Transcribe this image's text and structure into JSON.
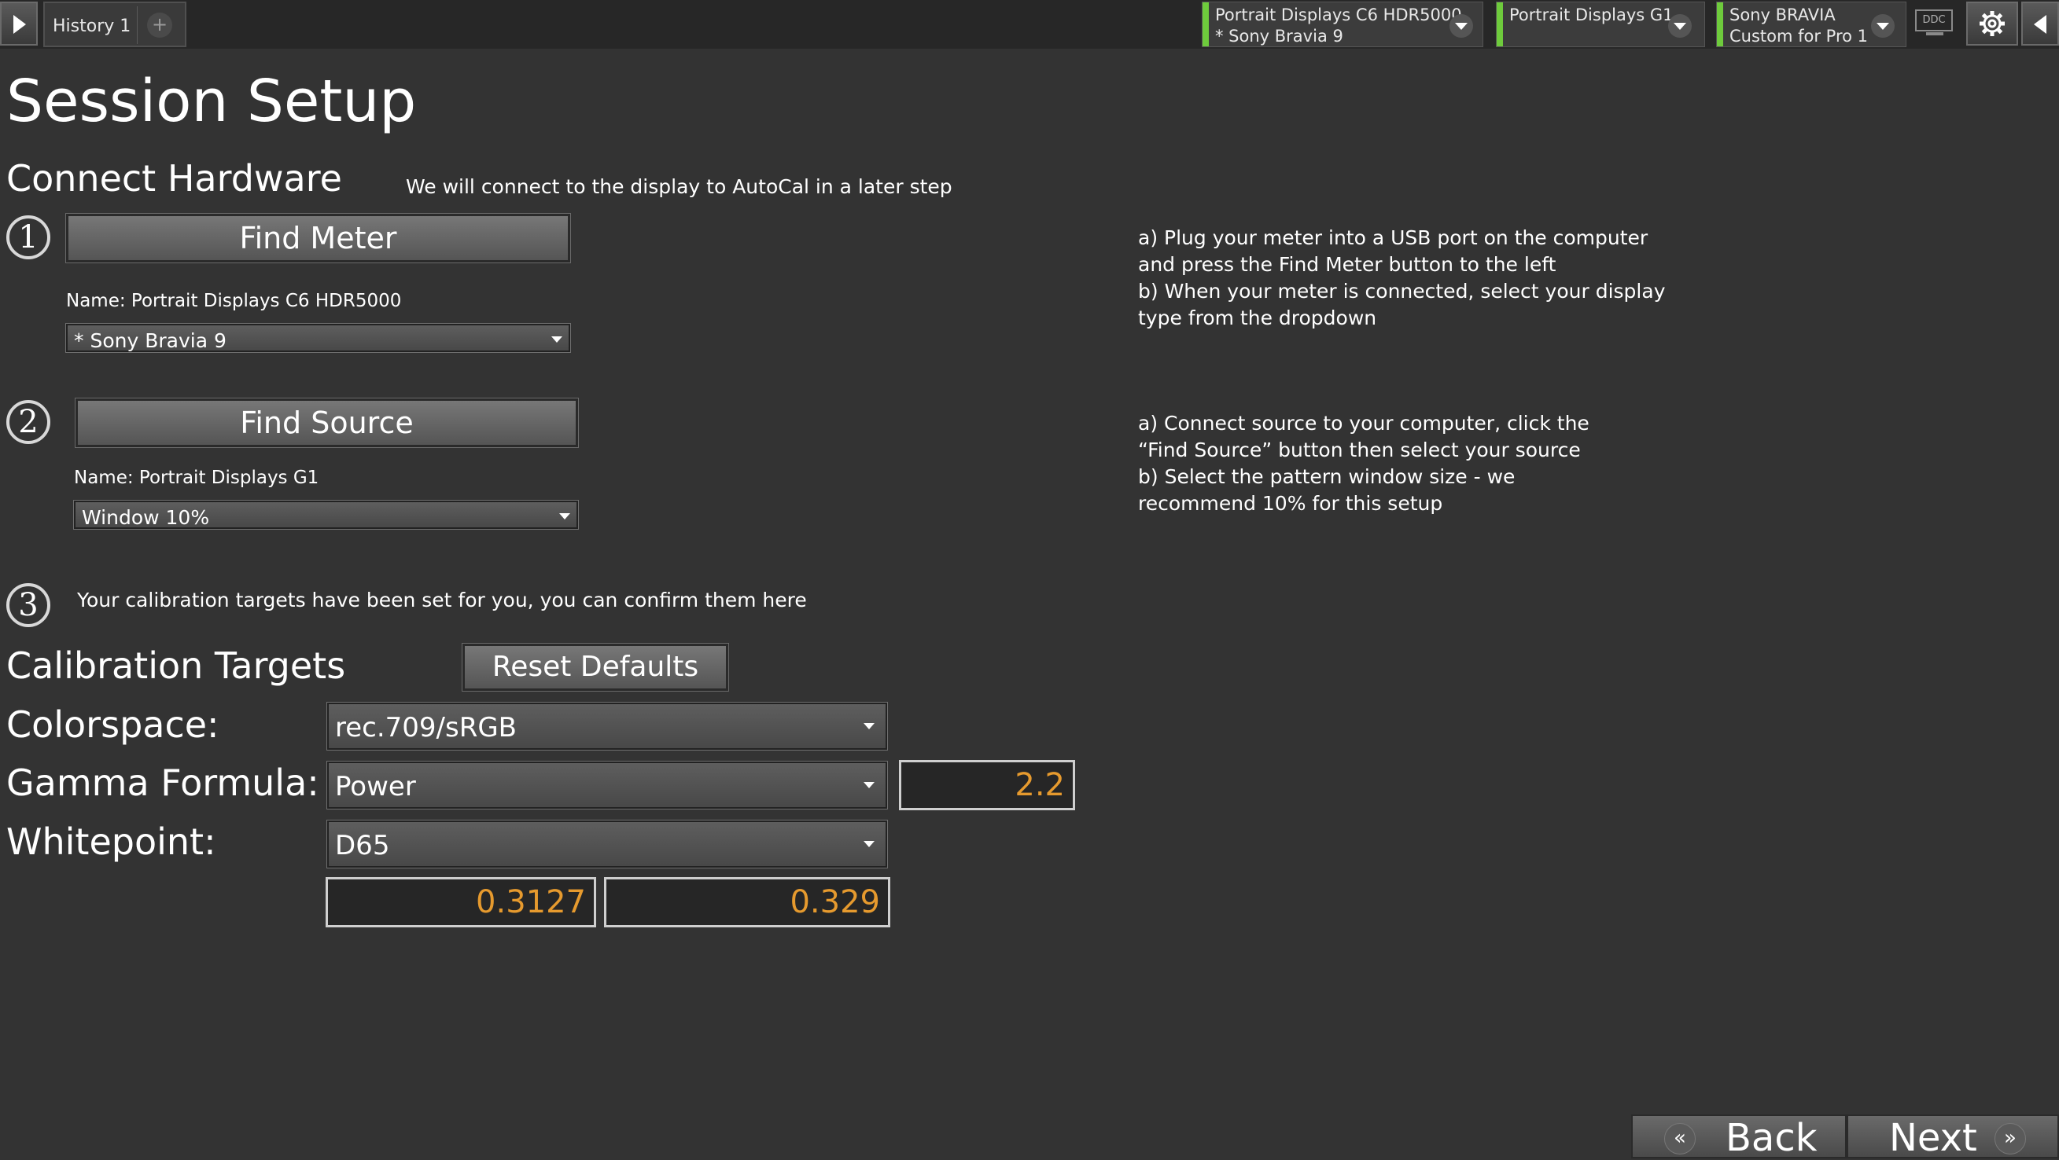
{
  "topbar": {
    "history_tab": "History 1",
    "add_tab": "+",
    "devices": [
      {
        "line1": "Portrait Displays C6 HDR5000",
        "line2": "* Sony Bravia 9"
      },
      {
        "line1": "Portrait Displays G1",
        "line2": ""
      },
      {
        "line1": "Sony BRAVIA",
        "line2": "Custom for Pro 1"
      }
    ],
    "ddc_label": "DDC",
    "status_color": "#6ecb3c"
  },
  "page_title": "Session Setup",
  "connect": {
    "title": "Connect Hardware",
    "note": "We will connect to the display to AutoCal in a later step",
    "step1": {
      "number": "1",
      "button": "Find Meter",
      "name_label": "Name: Portrait Displays C6 HDR5000",
      "dropdown_value": "* Sony Bravia 9",
      "help": "a) Plug your meter into a USB port on the computer\nand press the Find Meter button to the left\nb) When your meter is connected, select your display\ntype from the dropdown"
    },
    "step2": {
      "number": "2",
      "button": "Find Source",
      "name_label": "Name: Portrait Displays G1",
      "dropdown_value": "Window 10%",
      "help": "a)  Connect source to your computer, click the\n“Find Source” button then select your source\nb)  Select the pattern window size - we\nrecommend 10% for this setup"
    },
    "step3": {
      "number": "3",
      "text": "Your calibration targets have been set for you, you can confirm them here"
    }
  },
  "targets": {
    "title": "Calibration Targets",
    "reset_button": "Reset Defaults",
    "colorspace_label": "Colorspace:",
    "colorspace_value": "rec.709/sRGB",
    "gamma_label": "Gamma Formula:",
    "gamma_value": "Power",
    "gamma_number": "2.2",
    "whitepoint_label": "Whitepoint:",
    "whitepoint_value": "D65",
    "whitepoint_x": "0.3127",
    "whitepoint_y": "0.329",
    "value_color": "#e69a2e"
  },
  "nav": {
    "back_icon": "«",
    "back": "Back",
    "next": "Next",
    "next_icon": "»"
  }
}
